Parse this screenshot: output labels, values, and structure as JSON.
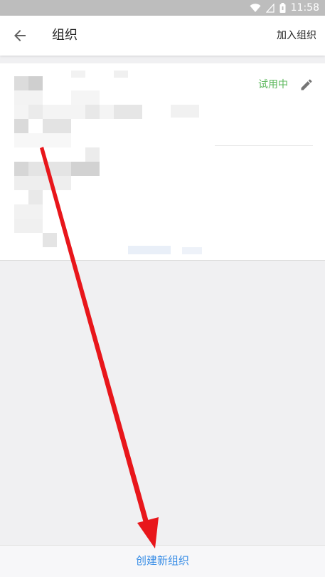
{
  "status_bar": {
    "time": "11:58"
  },
  "header": {
    "title": "组织",
    "join_label": "加入组织"
  },
  "org_card": {
    "status": "试用中"
  },
  "footer": {
    "create_label": "创建新组织"
  },
  "colors": {
    "accent": "#3a8ee6",
    "trial": "#5cb85c",
    "annotation_arrow": "#e8161b"
  }
}
